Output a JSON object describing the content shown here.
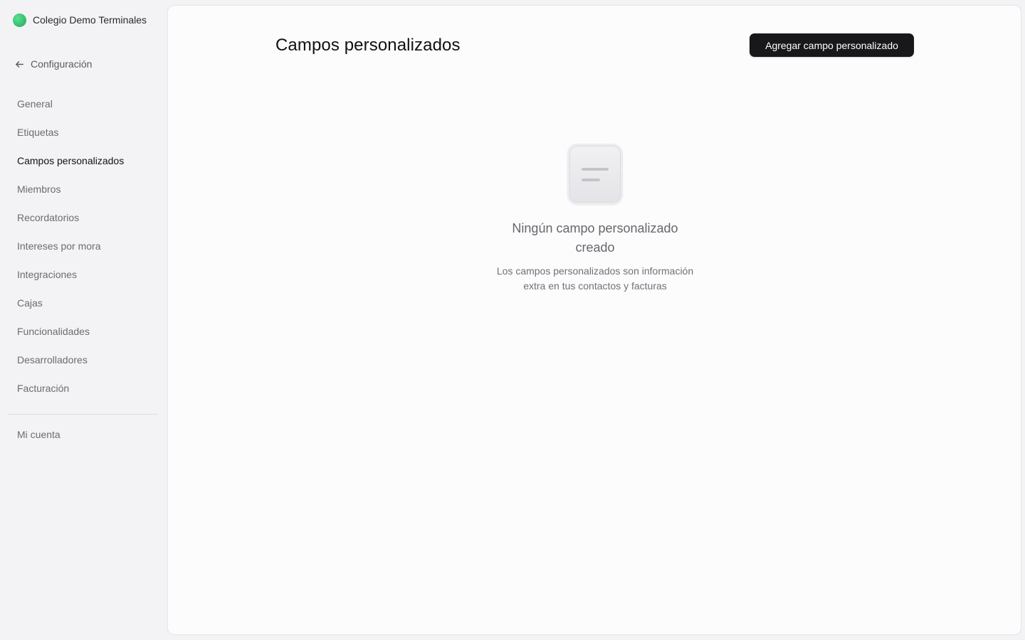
{
  "sidebar": {
    "org_name": "Colegio Demo Terminales",
    "back_label": "Configuración",
    "items": [
      {
        "label": "General"
      },
      {
        "label": "Etiquetas"
      },
      {
        "label": "Campos personalizados"
      },
      {
        "label": "Miembros"
      },
      {
        "label": "Recordatorios"
      },
      {
        "label": "Intereses por mora"
      },
      {
        "label": "Integraciones"
      },
      {
        "label": "Cajas"
      },
      {
        "label": "Funcionalidades"
      },
      {
        "label": "Desarrolladores"
      },
      {
        "label": "Facturación"
      }
    ],
    "active_item": "Campos personalizados",
    "account_label": "Mi cuenta"
  },
  "main": {
    "title": "Campos personalizados",
    "add_button_label": "Agregar campo personalizado",
    "empty_state": {
      "icon": "document-lines-icon",
      "title": "Ningún campo personalizado creado",
      "description": "Los campos personalizados son información extra en tus contactos y facturas"
    }
  },
  "colors": {
    "accent_org": "#2fc06d",
    "primary_button": "#18181b",
    "sidebar_bg": "#f3f3f5",
    "panel_bg": "#fcfcfd"
  }
}
